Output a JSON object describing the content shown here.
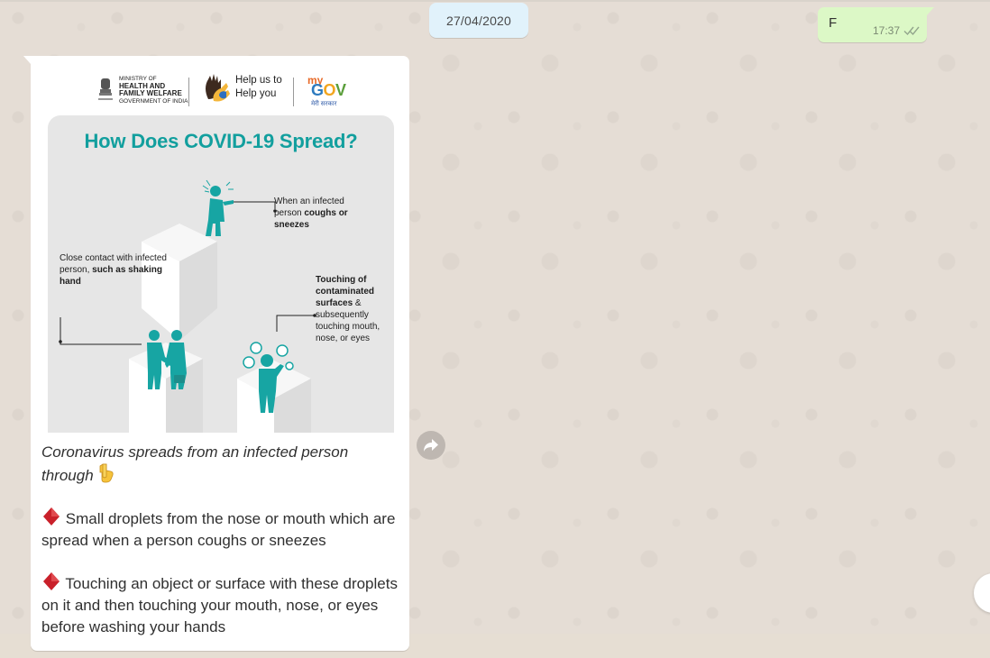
{
  "chat": {
    "date_chip": "27/04/2020",
    "outgoing": {
      "text": "F",
      "time": "17:37",
      "status_icon": "double-check-icon"
    },
    "incoming": {
      "poster": {
        "ministry": {
          "line1": "MINISTRY OF",
          "line2": "HEALTH AND",
          "line3": "FAMILY WELFARE",
          "line4": "GOVERNMENT OF INDIA"
        },
        "help_logo": {
          "line1": "Help us to",
          "line2": "Help you"
        },
        "mygov": {
          "my": "my",
          "gov_g": "G",
          "gov_o": "O",
          "gov_v": "V",
          "subtitle": "मेरी सरकार"
        },
        "title": "How Does COVID-19 Spread?",
        "captions": {
          "cough_plain": "When an infected person ",
          "cough_bold": "coughs or sneezes",
          "contact_plain": "Close contact with infected person, ",
          "contact_bold": "such as shaking hand",
          "touch_bold": "Touching of contaminated surfaces",
          "touch_plain": " & subsequently touching mouth, nose, or eyes"
        }
      },
      "intro_text": "Coronavirus spreads from an infected person through",
      "intro_emoji": "pointing-down-emoji",
      "bullets": [
        {
          "icon": "red-diamond-emoji",
          "text": "Small droplets from the nose or mouth which are spread when a person coughs or sneezes"
        },
        {
          "icon": "red-diamond-emoji",
          "text": "Touching an object or surface with these droplets on it and then touching your mouth, nose, or eyes before washing your hands"
        }
      ]
    }
  },
  "colors": {
    "wallpaper": "#e5ddd5",
    "outgoing_bubble": "#dcf8c6",
    "incoming_bubble": "#ffffff",
    "date_chip": "#e1f2fb",
    "poster_teal": "#129f9e"
  }
}
